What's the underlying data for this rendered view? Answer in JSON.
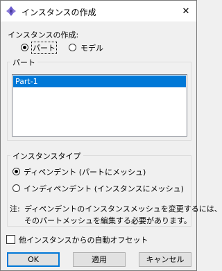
{
  "window": {
    "title": "インスタンスの作成",
    "close_glyph": "✕"
  },
  "create_label": "インスタンスの作成:",
  "create_type": {
    "options": [
      {
        "label": "パート",
        "checked": true
      },
      {
        "label": "モデル",
        "checked": false
      }
    ]
  },
  "parts_group": {
    "title": "パート",
    "items": [
      {
        "label": "Part-1",
        "selected": true
      }
    ]
  },
  "instance_type_group": {
    "title": "インスタンスタイプ",
    "options": [
      {
        "label": "ディペンデント (パートにメッシュ)",
        "checked": true
      },
      {
        "label": "インディペンデント (インスタンスにメッシュ)",
        "checked": false
      }
    ],
    "note_prefix": "注:",
    "note_line1": "ディペンデントのインスタンスメッシュを変更するには、",
    "note_line2": "そのパートメッシュを編集する必要があります。"
  },
  "auto_offset": {
    "label": "他インスタンスからの自動オフセット",
    "checked": false
  },
  "buttons": {
    "ok": "OK",
    "apply": "適用",
    "cancel": "キャンセル"
  },
  "colors": {
    "selection": "#0078d7",
    "default_border": "#0078d7",
    "icon": "#6a5acd"
  }
}
